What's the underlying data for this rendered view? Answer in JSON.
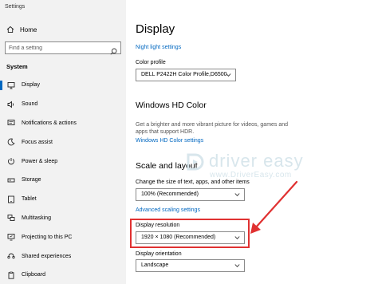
{
  "window": {
    "title": "Settings"
  },
  "sidebar": {
    "home_label": "Home",
    "search_placeholder": "Find a setting",
    "section": "System",
    "items": [
      {
        "label": "Display",
        "icon": "monitor-icon",
        "active": true
      },
      {
        "label": "Sound",
        "icon": "speaker-icon"
      },
      {
        "label": "Notifications & actions",
        "icon": "notification-icon"
      },
      {
        "label": "Focus assist",
        "icon": "moon-icon"
      },
      {
        "label": "Power & sleep",
        "icon": "power-icon"
      },
      {
        "label": "Storage",
        "icon": "storage-icon"
      },
      {
        "label": "Tablet",
        "icon": "tablet-icon"
      },
      {
        "label": "Multitasking",
        "icon": "multitasking-icon"
      },
      {
        "label": "Projecting to this PC",
        "icon": "projecting-icon"
      },
      {
        "label": "Shared experiences",
        "icon": "shared-icon"
      },
      {
        "label": "Clipboard",
        "icon": "clipboard-icon"
      }
    ]
  },
  "main": {
    "title": "Display",
    "night_light_link": "Night light settings",
    "color_profile_label": "Color profile",
    "color_profile_value": "DELL P2422H  Color Profile,D6500",
    "hd_color_heading": "Windows HD Color",
    "hd_color_desc": "Get a brighter and more vibrant picture for videos, games and apps that support HDR.",
    "hd_color_link": "Windows HD Color settings",
    "scale_heading": "Scale and layout",
    "scale_label": "Change the size of text, apps, and other items",
    "scale_value": "100% (Recommended)",
    "advanced_scaling_link": "Advanced scaling settings",
    "resolution_label": "Display resolution",
    "resolution_value": "1920 × 1080 (Recommended)",
    "orientation_label": "Display orientation",
    "orientation_value": "Landscape"
  },
  "watermark": {
    "text": "driver easy",
    "url": "www.DriverEasy.com"
  },
  "colors": {
    "accent": "#0067c0",
    "annotation": "#e03131",
    "sidebar_bg": "#f2f2f2"
  }
}
